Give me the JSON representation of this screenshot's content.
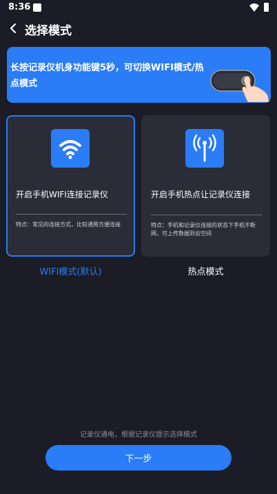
{
  "status_bar": {
    "time": "8:36",
    "icons": [
      "notification-square-icon",
      "wifi-signal-icon",
      "battery-icon"
    ]
  },
  "header": {
    "title": "选择模式",
    "back_icon": "chevron-left-icon"
  },
  "banner": {
    "text": "长按记录仪机身功能键5秒，可切换WIFI模式/热点模式",
    "illustration": "device-press-hand-icon"
  },
  "modes": [
    {
      "label": "WIFI模式(默认)",
      "title": "开启手机WIFI连接记录仪",
      "description": "特点：常见的连接方式，比较通用方便连接",
      "icon": "wifi-icon",
      "selected": true
    },
    {
      "label": "热点模式",
      "title": "开启手机热点让记录仪连接",
      "description": "特点：手机和记录仪连接的状态下手机不断网，可上传数据到云空间",
      "icon": "antenna-icon",
      "selected": false
    }
  ],
  "footer": {
    "hint": "记录仪通电，根据记录仪提示选择模式",
    "next_label": "下一步"
  },
  "colors": {
    "background": "#1b1c25",
    "accent": "#2a7cf7",
    "card": "#2a2c37"
  }
}
